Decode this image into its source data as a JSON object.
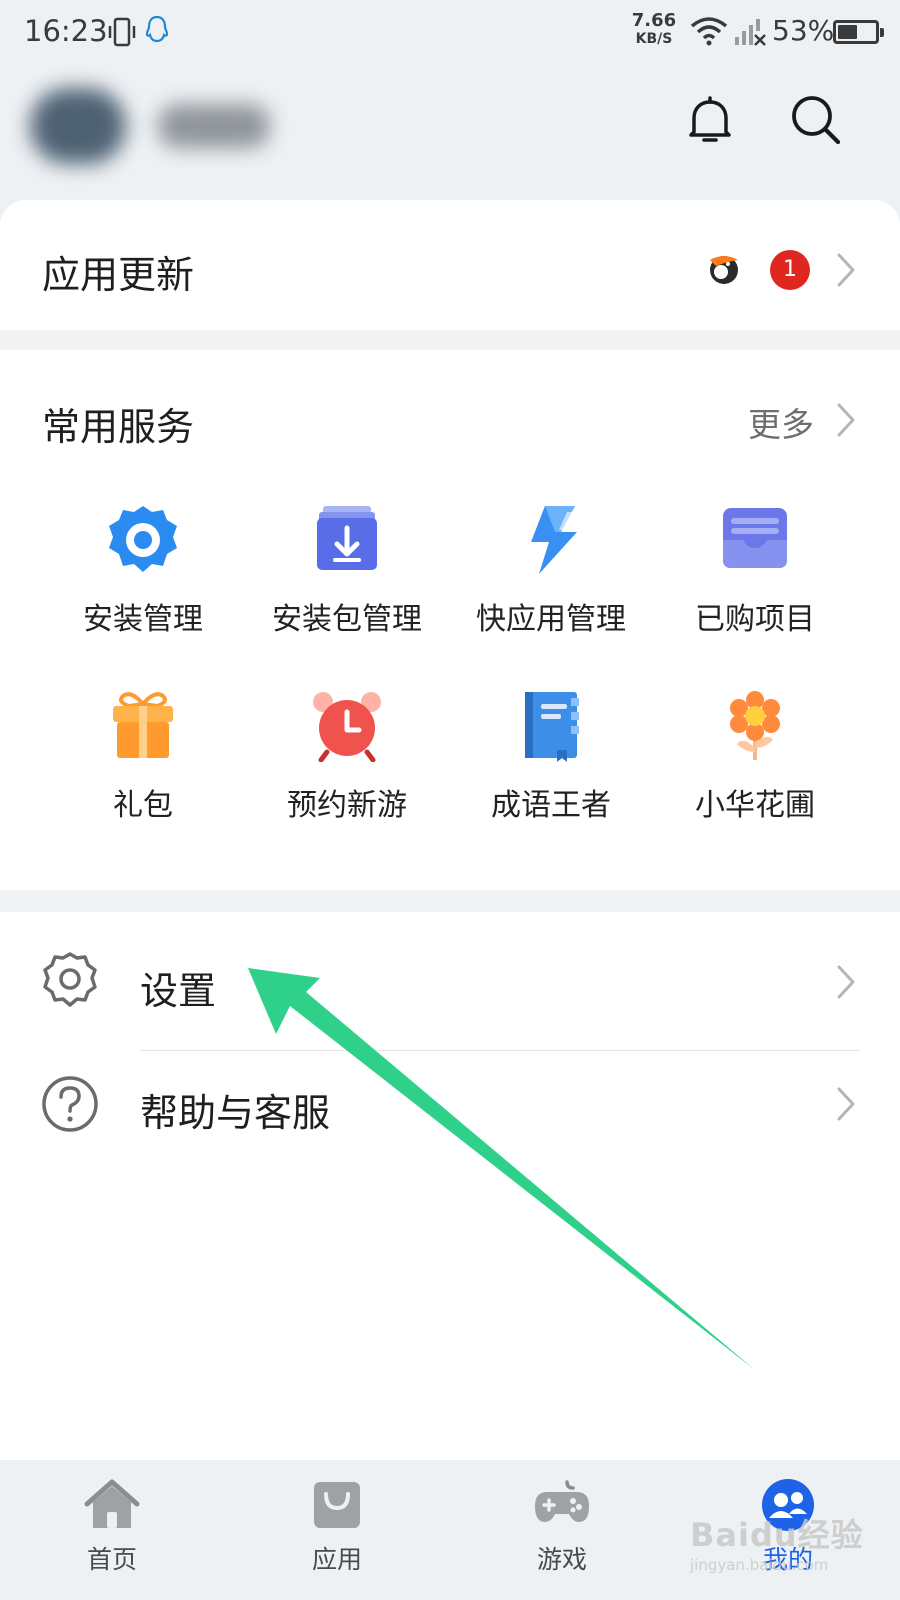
{
  "status_bar": {
    "time": "16:23",
    "net_speed_value": "7.66",
    "net_speed_unit": "KB/S",
    "battery_percent": "53%",
    "battery_level": 0.53,
    "icons": [
      "vibrate-icon",
      "qq-icon",
      "wifi-icon",
      "signal-off-icon",
      "battery-icon"
    ]
  },
  "header": {
    "icons": [
      "bell-icon",
      "search-icon"
    ]
  },
  "updates": {
    "title": "应用更新",
    "badge_count": "1"
  },
  "services": {
    "title": "常用服务",
    "more_label": "更多",
    "items": [
      {
        "label": "安装管理",
        "icon": "install-manager-gear-icon",
        "color": "#2a8cf0"
      },
      {
        "label": "安装包管理",
        "icon": "package-download-icon",
        "color": "#5a6de8"
      },
      {
        "label": "快应用管理",
        "icon": "lightning-icon",
        "color": "#3a8ff2"
      },
      {
        "label": "已购项目",
        "icon": "purchased-wallet-icon",
        "color": "#6c78ea"
      },
      {
        "label": "礼包",
        "icon": "gift-icon",
        "color": "#ff9a2e"
      },
      {
        "label": "预约新游",
        "icon": "alarm-clock-icon",
        "color": "#f0524e"
      },
      {
        "label": "成语王者",
        "icon": "book-icon",
        "color": "#3d8ee6"
      },
      {
        "label": "小华花圃",
        "icon": "flower-icon",
        "color": "#ff8a3c"
      }
    ]
  },
  "list": {
    "settings_label": "设置",
    "help_label": "帮助与客服"
  },
  "bottom_nav": {
    "items": [
      {
        "label": "首页",
        "icon": "home-icon"
      },
      {
        "label": "应用",
        "icon": "shopping-bag-icon"
      },
      {
        "label": "游戏",
        "icon": "gamepad-icon"
      },
      {
        "label": "我的",
        "icon": "profile-icon"
      }
    ],
    "active_color": "#1e63e6"
  },
  "annotation": {
    "arrow_color": "#2fd08a"
  },
  "watermark": {
    "text": "Baidu经验",
    "sub": "jingyan.baidu.com"
  }
}
